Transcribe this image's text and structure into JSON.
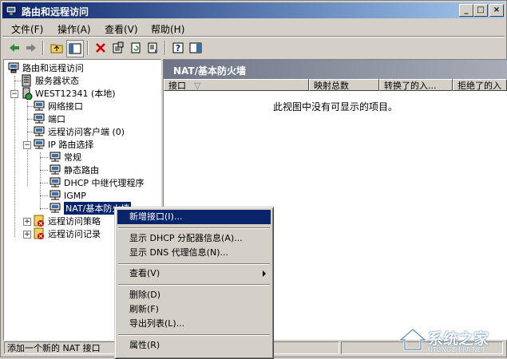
{
  "window": {
    "title": "路由和远程访问",
    "controls": [
      "_",
      "□",
      "×"
    ]
  },
  "menubar": [
    "文件(F)",
    "操作(A)",
    "查看(V)",
    "帮助(H)"
  ],
  "toolbar_icons": [
    "back-icon",
    "forward-icon",
    "up-folder-icon",
    "show-tree-icon",
    "delete-icon",
    "properties-icon",
    "refresh-icon",
    "export-icon",
    "help-icon",
    "console-icon"
  ],
  "tree": {
    "root": "路由和远程访问",
    "server_status": "服务器状态",
    "server": "WEST12341 (本地)",
    "items": {
      "net_if": "网络接口",
      "ports": "端口",
      "remote_clients": "远程访问客户端 (0)",
      "ip_routing": "IP 路由选择",
      "general": "常规",
      "static_routes": "静态路由",
      "dhcp_relay": "DHCP 中继代理程序",
      "igmp": "IGMP",
      "nat": "NAT/基本防火墙",
      "policies": "远程访问策略",
      "logging": "远程访问记录"
    }
  },
  "right": {
    "header": "NAT/基本防火墙",
    "columns": [
      "接口",
      "映射总数",
      "转换了的入...",
      "拒绝了的入"
    ],
    "empty_message": "此视图中没有可显示的项目。"
  },
  "context_menu": {
    "new_interface": "新增接口(I)...",
    "show_dhcp": "显示 DHCP 分配器信息(A)...",
    "show_dns": "显示 DNS 代理信息(N)...",
    "view": "查看(V)",
    "delete": "删除(D)",
    "refresh": "刷新(F)",
    "export": "导出列表(L)...",
    "properties": "属性(R)"
  },
  "status": {
    "text": "添加一个新的 NAT 接口"
  },
  "watermark": {
    "brand": "系统之家",
    "url": "XITONGZHIJIA.NET"
  }
}
